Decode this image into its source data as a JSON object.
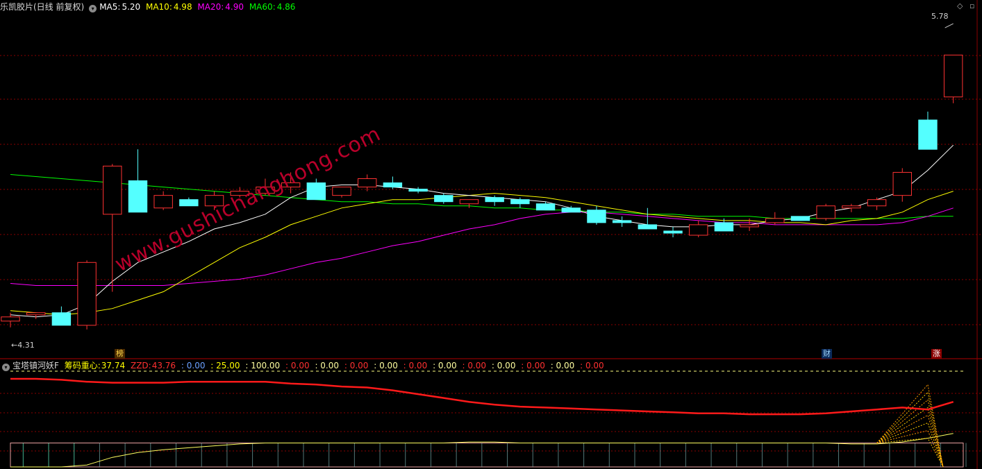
{
  "main_header": {
    "title": "乐凯胶片(日线 前复权)",
    "ma5_label": "MA5:",
    "ma5_value": "5.20",
    "ma10_label": "MA10:",
    "ma10_value": "4.98",
    "ma20_label": "MA20:",
    "ma20_value": "4.90",
    "ma60_label": "MA60:",
    "ma60_value": "4.86"
  },
  "sub_header": {
    "title": "宝塔镇河妖F",
    "chip_label": "筹码重心:",
    "chip_value": "37.74",
    "zzd_label": "ZZD:",
    "zzd_value": "43.76",
    "v1": ": 0.00",
    "v2": ": 25.00",
    "v3": ": 100.00",
    "v4": ": 0.00",
    "v5": ": 0.00",
    "v6": ": 0.00",
    "v7": ": 0.00",
    "v8": ": 0.00",
    "v9": ": 0.00",
    "v10": ": 0.00",
    "v11": ": 0.00",
    "v12": ": 0.00",
    "v13": ": 0.00",
    "v14": ": 0.00"
  },
  "annotations": {
    "high_label": "5.78",
    "low_label": "4.31",
    "watermark": "www.gushichanghong.com",
    "tag_rank": "榜",
    "tag_finance": "财",
    "tag_rise": "涨"
  },
  "colors": {
    "up": "#ff3232",
    "down": "#54ffff",
    "ma5": "#ffffff",
    "ma10": "#ffff00",
    "ma20": "#ff00ff",
    "ma60": "#00ff00",
    "grid": "#8b0000",
    "chip": "#ff1a1a"
  },
  "chart_data": {
    "type": "candlestick",
    "ylim": [
      4.27,
      5.8
    ],
    "candles": [
      {
        "o": 4.36,
        "h": 4.4,
        "l": 4.33,
        "c": 4.38
      },
      {
        "o": 4.39,
        "h": 4.4,
        "l": 4.37,
        "c": 4.4
      },
      {
        "o": 4.4,
        "h": 4.43,
        "l": 4.34,
        "c": 4.34
      },
      {
        "o": 4.34,
        "h": 4.65,
        "l": 4.32,
        "c": 4.64
      },
      {
        "o": 4.87,
        "h": 5.11,
        "l": 4.5,
        "c": 5.1
      },
      {
        "o": 5.03,
        "h": 5.18,
        "l": 4.88,
        "c": 4.88
      },
      {
        "o": 4.9,
        "h": 4.98,
        "l": 4.89,
        "c": 4.96
      },
      {
        "o": 4.94,
        "h": 4.95,
        "l": 4.91,
        "c": 4.91
      },
      {
        "o": 4.91,
        "h": 4.98,
        "l": 4.89,
        "c": 4.96
      },
      {
        "o": 4.96,
        "h": 5.0,
        "l": 4.95,
        "c": 4.98
      },
      {
        "o": 4.97,
        "h": 5.04,
        "l": 4.96,
        "c": 5.0
      },
      {
        "o": 5.0,
        "h": 5.07,
        "l": 4.97,
        "c": 5.02
      },
      {
        "o": 5.02,
        "h": 5.04,
        "l": 4.94,
        "c": 4.94
      },
      {
        "o": 4.96,
        "h": 5.0,
        "l": 4.95,
        "c": 5.0
      },
      {
        "o": 5.0,
        "h": 5.06,
        "l": 4.98,
        "c": 5.04
      },
      {
        "o": 5.02,
        "h": 5.05,
        "l": 4.99,
        "c": 5.0
      },
      {
        "o": 4.99,
        "h": 5.0,
        "l": 4.97,
        "c": 4.98
      },
      {
        "o": 4.96,
        "h": 4.97,
        "l": 4.92,
        "c": 4.93
      },
      {
        "o": 4.92,
        "h": 4.94,
        "l": 4.9,
        "c": 4.94
      },
      {
        "o": 4.95,
        "h": 4.96,
        "l": 4.91,
        "c": 4.93
      },
      {
        "o": 4.94,
        "h": 4.95,
        "l": 4.9,
        "c": 4.92
      },
      {
        "o": 4.92,
        "h": 4.93,
        "l": 4.89,
        "c": 4.89
      },
      {
        "o": 4.9,
        "h": 4.91,
        "l": 4.88,
        "c": 4.88
      },
      {
        "o": 4.89,
        "h": 4.91,
        "l": 4.82,
        "c": 4.83
      },
      {
        "o": 4.84,
        "h": 4.86,
        "l": 4.81,
        "c": 4.83
      },
      {
        "o": 4.82,
        "h": 4.9,
        "l": 4.8,
        "c": 4.8
      },
      {
        "o": 4.79,
        "h": 4.81,
        "l": 4.76,
        "c": 4.78
      },
      {
        "o": 4.77,
        "h": 4.84,
        "l": 4.76,
        "c": 4.82
      },
      {
        "o": 4.83,
        "h": 4.85,
        "l": 4.79,
        "c": 4.79
      },
      {
        "o": 4.81,
        "h": 4.85,
        "l": 4.79,
        "c": 4.82
      },
      {
        "o": 4.83,
        "h": 4.88,
        "l": 4.82,
        "c": 4.85
      },
      {
        "o": 4.86,
        "h": 4.86,
        "l": 4.84,
        "c": 4.84
      },
      {
        "o": 4.85,
        "h": 4.92,
        "l": 4.84,
        "c": 4.91
      },
      {
        "o": 4.9,
        "h": 4.92,
        "l": 4.88,
        "c": 4.91
      },
      {
        "o": 4.91,
        "h": 4.95,
        "l": 4.89,
        "c": 4.94
      },
      {
        "o": 4.96,
        "h": 5.09,
        "l": 4.93,
        "c": 5.07
      },
      {
        "o": 5.32,
        "h": 5.36,
        "l": 5.18,
        "c": 5.18
      },
      {
        "o": 5.43,
        "h": 5.62,
        "l": 5.4,
        "c": 5.63
      }
    ],
    "ma5": [
      4.39,
      4.38,
      4.39,
      4.44,
      4.55,
      4.64,
      4.69,
      4.74,
      4.8,
      4.83,
      4.87,
      4.95,
      5.0,
      5.01,
      5.01,
      5.0,
      4.99,
      4.97,
      4.96,
      4.95,
      4.94,
      4.93,
      4.9,
      4.86,
      4.84,
      4.82,
      4.81,
      4.81,
      4.82,
      4.82,
      4.84,
      4.85,
      4.88,
      4.9,
      4.94,
      4.98,
      5.08,
      5.2
    ],
    "ma10": [
      4.41,
      4.4,
      4.39,
      4.4,
      4.42,
      4.46,
      4.5,
      4.57,
      4.64,
      4.71,
      4.76,
      4.82,
      4.86,
      4.9,
      4.92,
      4.94,
      4.94,
      4.95,
      4.96,
      4.97,
      4.96,
      4.95,
      4.93,
      4.91,
      4.89,
      4.87,
      4.86,
      4.85,
      4.84,
      4.84,
      4.83,
      4.83,
      4.82,
      4.84,
      4.85,
      4.88,
      4.94,
      4.98
    ],
    "ma20": [
      4.54,
      4.53,
      4.53,
      4.53,
      4.53,
      4.53,
      4.53,
      4.54,
      4.55,
      4.56,
      4.58,
      4.61,
      4.64,
      4.66,
      4.69,
      4.72,
      4.74,
      4.77,
      4.8,
      4.82,
      4.85,
      4.87,
      4.88,
      4.88,
      4.87,
      4.86,
      4.85,
      4.84,
      4.83,
      4.83,
      4.82,
      4.82,
      4.82,
      4.82,
      4.82,
      4.83,
      4.86,
      4.9
    ],
    "ma60": [
      5.06,
      5.05,
      5.04,
      5.03,
      5.02,
      5.01,
      5.0,
      4.99,
      4.98,
      4.97,
      4.96,
      4.95,
      4.94,
      4.93,
      4.93,
      4.92,
      4.92,
      4.91,
      4.91,
      4.9,
      4.9,
      4.89,
      4.89,
      4.88,
      4.88,
      4.87,
      4.87,
      4.86,
      4.86,
      4.86,
      4.85,
      4.85,
      4.85,
      4.85,
      4.85,
      4.85,
      4.86,
      4.86
    ],
    "indicator": {
      "ylim": [
        0,
        100
      ],
      "chip_center": [
        92,
        92,
        91,
        89,
        88,
        88,
        88,
        89,
        89,
        89,
        89,
        87,
        86,
        84,
        83,
        80,
        76,
        72,
        68,
        65,
        63,
        62,
        61,
        60,
        59,
        58,
        57,
        56,
        56,
        55,
        55,
        55,
        56,
        58,
        60,
        62,
        60,
        68
      ],
      "level_line": 25,
      "dashed_line": 100
    }
  }
}
